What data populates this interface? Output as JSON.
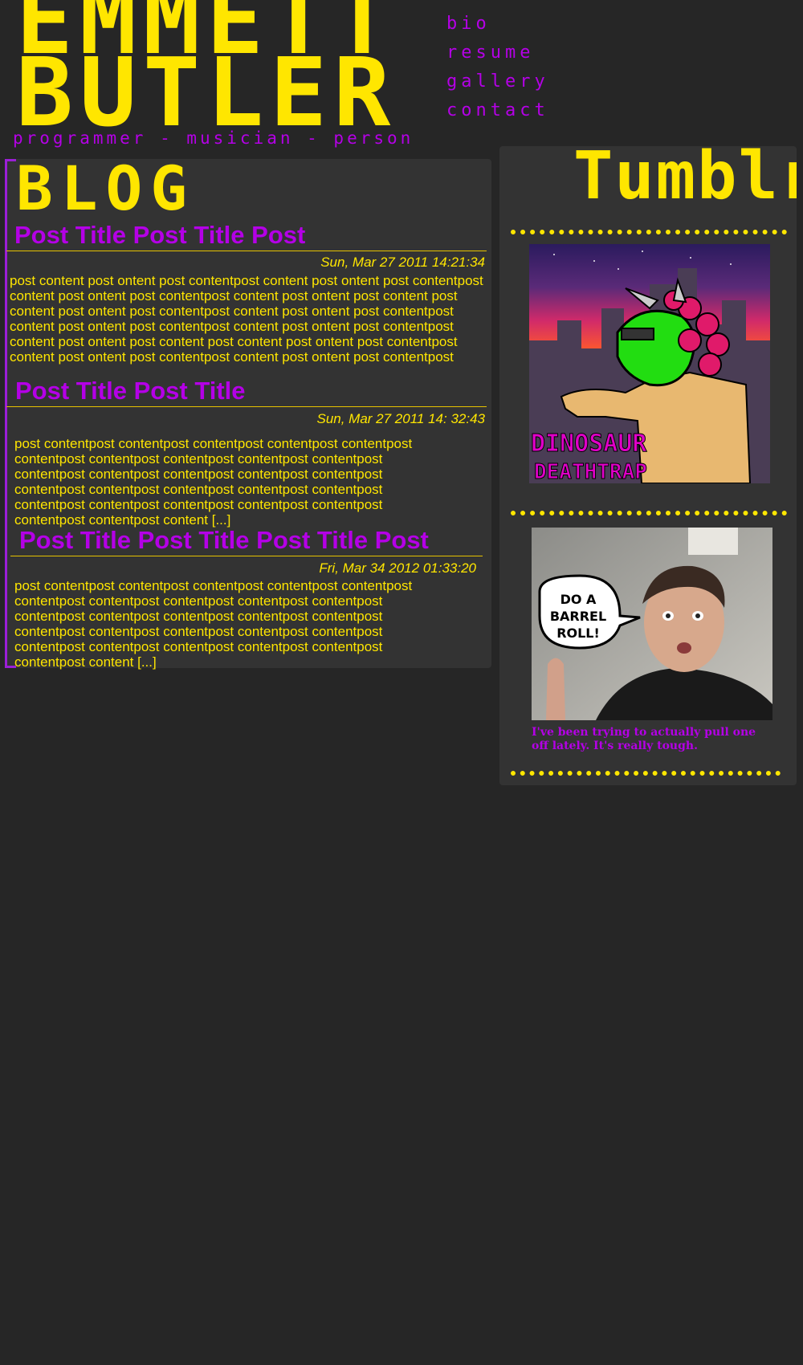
{
  "header": {
    "title_line1": "EMMETT",
    "title_line2": "BUTLER",
    "tagline": "programmer - musician - person"
  },
  "nav": {
    "items": [
      {
        "label": "bio"
      },
      {
        "label": "resume"
      },
      {
        "label": "gallery"
      },
      {
        "label": "contact"
      }
    ]
  },
  "blog": {
    "heading": "BLOG",
    "posts": [
      {
        "title": "Post Title Post Title Post",
        "date": "Sun, Mar 27 2011 14:21:34",
        "body": "post content post ontent post contentpost content post ontent post contentpost content post ontent post contentpost content post ontent post content post content post ontent post contentpost content post ontent post contentpost content post ontent post contentpost content post ontent post contentpost content post ontent post content post content post ontent post contentpost content post ontent post contentpost content post ontent post contentpost"
      },
      {
        "title": "Post Title Post Title",
        "date": "Sun, Mar 27 2011 14: 32:43",
        "body": "post contentpost contentpost contentpost contentpost contentpost contentpost contentpost contentpost contentpost contentpost contentpost contentpost contentpost contentpost contentpost contentpost contentpost contentpost contentpost contentpost contentpost contentpost contentpost contentpost contentpost contentpost contentpost content [...]"
      },
      {
        "title": "Post Title Post Title Post Title Post",
        "date": "Fri, Mar 34 2012 01:33:20",
        "body": "post contentpost contentpost contentpost contentpost contentpost contentpost contentpost contentpost contentpost contentpost contentpost contentpost contentpost contentpost contentpost contentpost contentpost contentpost contentpost contentpost contentpost contentpost contentpost contentpost contentpost contentpost content [...]"
      }
    ]
  },
  "tumblr": {
    "heading": "Tumblr",
    "album_cover": {
      "line1": "DINOSAUR",
      "line2": "DEATHTRAP"
    },
    "photo": {
      "speech": [
        "DO A",
        "BARREL",
        "ROLL!"
      ],
      "caption": "I've been trying to actually pull one off lately. It's really tough."
    }
  },
  "colors": {
    "background": "#262626",
    "panel": "#333333",
    "yellow": "#ffe600",
    "purple": "#b400e6"
  }
}
